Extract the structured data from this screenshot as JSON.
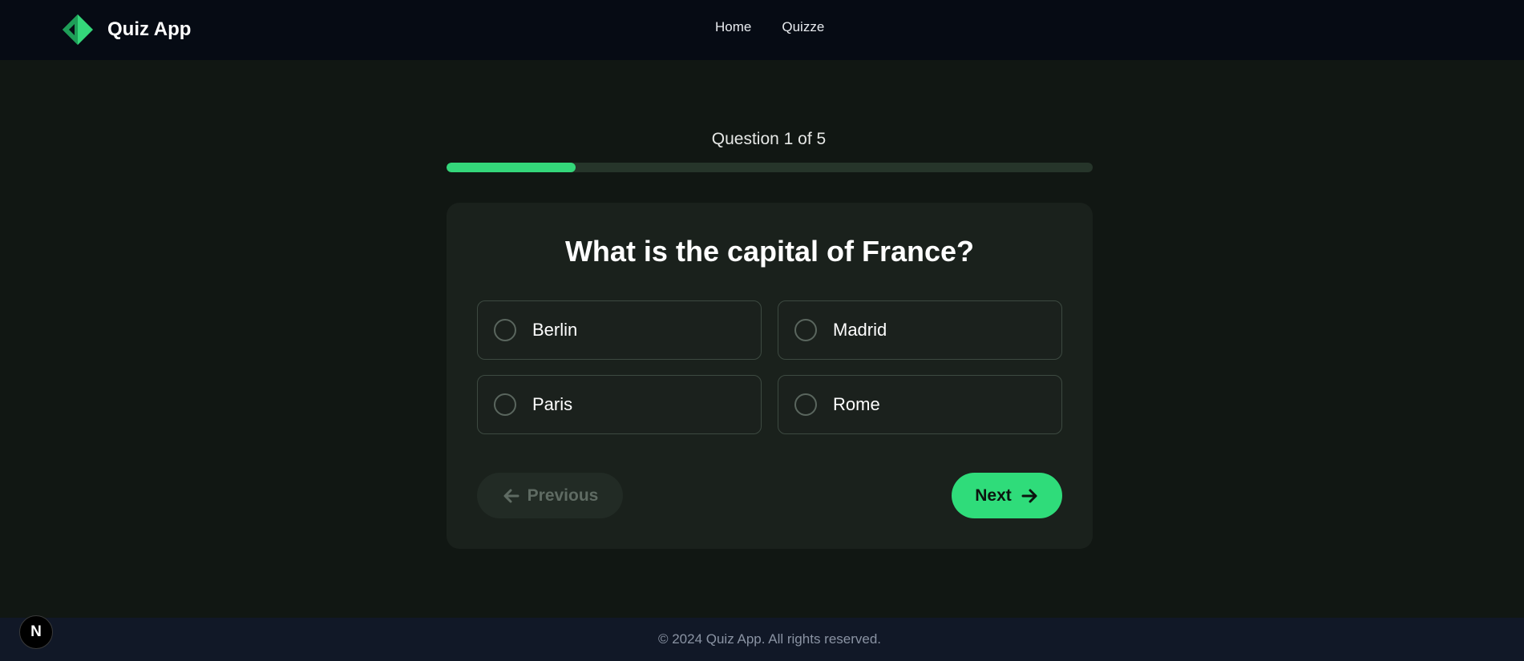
{
  "header": {
    "app_name": "Quiz App",
    "logo_icon": "diamond-logo-icon",
    "nav": [
      {
        "label": "Home"
      },
      {
        "label": "Quizze"
      }
    ]
  },
  "quiz": {
    "progress_text": "Question 1 of 5",
    "current_question": 1,
    "total_questions": 5,
    "progress_fraction": 0.2,
    "question": "What is the capital of France?",
    "options": [
      {
        "label": "Berlin",
        "selected": false
      },
      {
        "label": "Madrid",
        "selected": false
      },
      {
        "label": "Paris",
        "selected": false
      },
      {
        "label": "Rome",
        "selected": false
      }
    ],
    "previous_label": "Previous",
    "previous_disabled": true,
    "next_label": "Next"
  },
  "footer": {
    "copyright": "© 2024 Quiz App. All rights reserved."
  },
  "devtools_badge": {
    "label": "N",
    "icon": "nextjs-icon"
  },
  "colors": {
    "accent": "#34d77a",
    "page_background": "#111713",
    "header_background": "#060b14",
    "card_background": "#1a211c",
    "footer_background": "#111827"
  }
}
